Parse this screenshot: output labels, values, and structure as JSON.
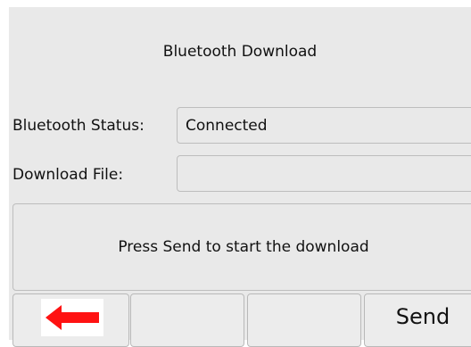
{
  "screen": {
    "title": "Bluetooth Download"
  },
  "fields": {
    "bluetooth_status": {
      "label": "Bluetooth Status:",
      "value": "Connected"
    },
    "download_file": {
      "label": "Download File:",
      "value": ""
    }
  },
  "message": {
    "text": "Press Send to start the download"
  },
  "softkeys": {
    "back": {
      "icon": "back-arrow-icon"
    },
    "key2": {
      "label": ""
    },
    "key3": {
      "label": ""
    },
    "send": {
      "label": "Send"
    }
  },
  "colors": {
    "panel_bg": "#e9e9e9",
    "border": "#bdbdbd",
    "arrow_red": "#ff1212"
  }
}
